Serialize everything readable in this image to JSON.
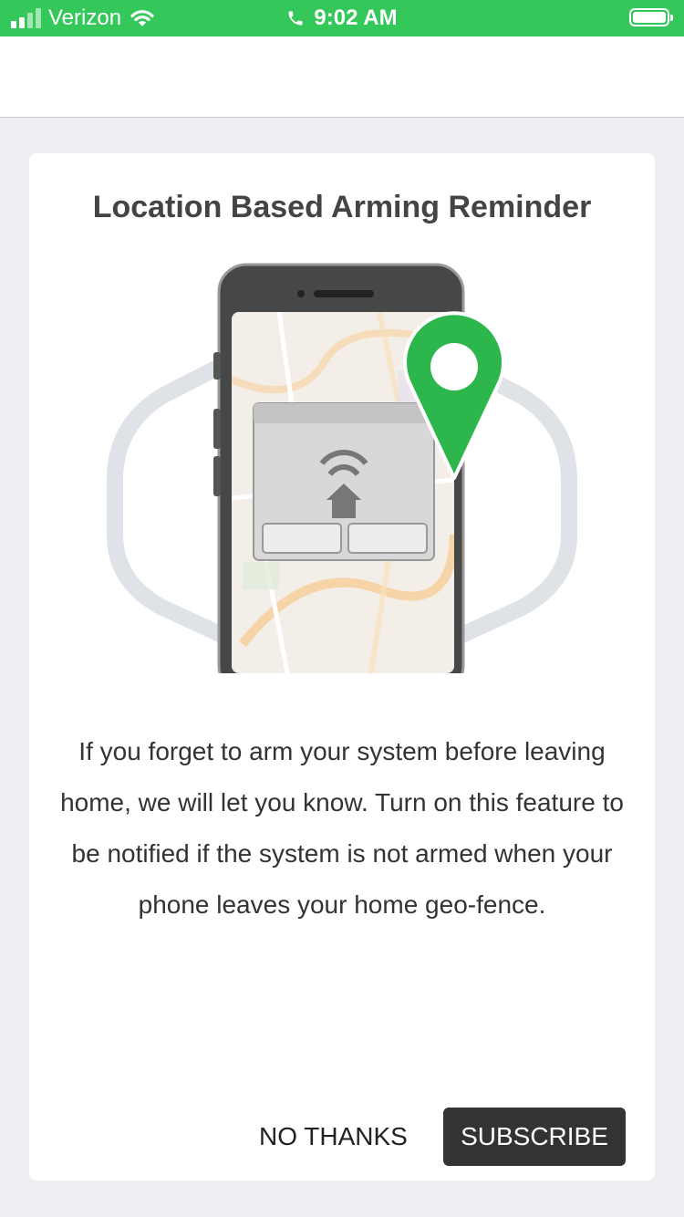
{
  "status_bar": {
    "carrier": "Verizon",
    "time": "9:02 AM",
    "signal_bars": 4,
    "signal_active": 2,
    "battery": "full"
  },
  "dialog": {
    "title": "Location Based Arming Reminder",
    "body": "If you forget to arm your system before leaving home, we will let you know. Turn on this feature to be notified if the system is not armed when your phone leaves your home geo-fence.",
    "buttons": {
      "no_thanks": "NO THANKS",
      "subscribe": "SUBSCRIBE"
    }
  },
  "colors": {
    "status_bar": "#34c759",
    "pin": "#2db64b",
    "subscribe_bg": "#333333",
    "background": "#eceef1"
  },
  "icons": [
    "signal-icon",
    "wifi-icon",
    "phone-icon",
    "battery-icon",
    "location-pin-icon",
    "home-icon"
  ]
}
